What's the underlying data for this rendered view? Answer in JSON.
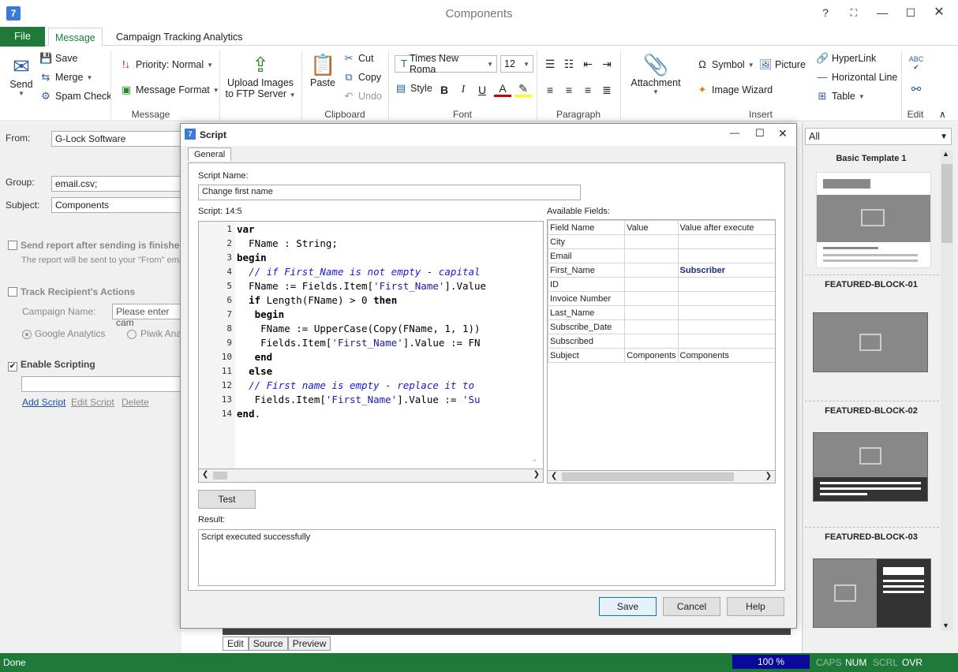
{
  "window": {
    "title": "Components"
  },
  "ribbon": {
    "file_tab": "File",
    "tabs": [
      "Message",
      "Campaign Tracking Analytics"
    ],
    "message": {
      "send": "Send",
      "save": "Save",
      "merge": "Merge",
      "spam_check": "Spam Check",
      "priority": "Priority: Normal",
      "format": "Message Format",
      "upload": "Upload Images",
      "upload2": "to FTP Server",
      "group": "Message"
    },
    "clipboard": {
      "paste": "Paste",
      "cut": "Cut",
      "copy": "Copy",
      "undo": "Undo",
      "group": "Clipboard"
    },
    "font": {
      "face": "Times New Roma",
      "size": "12",
      "style": "Style",
      "group": "Font"
    },
    "paragraph": {
      "group": "Paragraph"
    },
    "insert": {
      "attachment": "Attachment",
      "symbol": "Symbol",
      "picture": "Picture",
      "image_wizard": "Image Wizard",
      "hyperlink": "HyperLink",
      "hline": "Horizontal Line",
      "table": "Table",
      "group": "Insert"
    },
    "edit": {
      "group": "Edit"
    }
  },
  "left": {
    "from_label": "From:",
    "from_value": "G-Lock Software",
    "group_label": "Group:",
    "group_value": "email.csv;",
    "subject_label": "Subject:",
    "subject_value": "Components",
    "send_report": "Send report after sending is finished",
    "report_note": "The report will be sent to your \"From\" emai",
    "track": "Track Recipient's Actions",
    "campaign_label": "Campaign Name:",
    "campaign_placeholder": "Please enter cam",
    "google": "Google Analytics",
    "piwik": "Piwik Ana",
    "enable_scripting": "Enable Scripting",
    "add_script": "Add Script",
    "edit_script": "Edit Script",
    "delete": "Delete"
  },
  "right": {
    "filter": "All",
    "templates": [
      "Basic Template 1",
      "FEATURED-BLOCK-01",
      "FEATURED-BLOCK-02",
      "FEATURED-BLOCK-03"
    ]
  },
  "bottom_tabs": [
    "Edit",
    "Source",
    "Preview"
  ],
  "status": {
    "left": "Done",
    "zoom": "100 %",
    "caps": "CAPS",
    "num": "NUM",
    "scrl": "SCRL",
    "ovr": "OVR"
  },
  "dialog": {
    "title": "Script",
    "tab": "General",
    "name_label": "Script Name:",
    "name_value": "Change first name",
    "script_label": "Script: 14:5",
    "fields_label": "Available Fields:",
    "fields_headers": [
      "Field Name",
      "Value",
      "Value after execute"
    ],
    "fields_rows": [
      [
        "City",
        "",
        ""
      ],
      [
        "Email",
        "",
        ""
      ],
      [
        "First_Name",
        "",
        "Subscriber"
      ],
      [
        "ID",
        "",
        ""
      ],
      [
        "Invoice Number",
        "",
        ""
      ],
      [
        "Last_Name",
        "",
        ""
      ],
      [
        "Subscribe_Date",
        "",
        ""
      ],
      [
        "Subscribed",
        "",
        ""
      ],
      [
        "Subject",
        "Components",
        "Components"
      ]
    ],
    "code_lines": [
      "var",
      "  FName : String;",
      "begin",
      "  // if First_Name is not empty - capital",
      "  FName := Fields.Item['First_Name'].Value",
      "  if Length(FName) > 0 then",
      "   begin",
      "    FName := UpperCase(Copy(FName, 1, 1))",
      "    Fields.Item['First_Name'].Value := FN",
      "   end",
      "  else",
      "  // First name is empty - replace it to ",
      "   Fields.Item['First_Name'].Value := 'Su",
      "end."
    ],
    "test": "Test",
    "result_label": "Result:",
    "result_value": "Script executed successfully",
    "save": "Save",
    "cancel": "Cancel",
    "help": "Help"
  }
}
